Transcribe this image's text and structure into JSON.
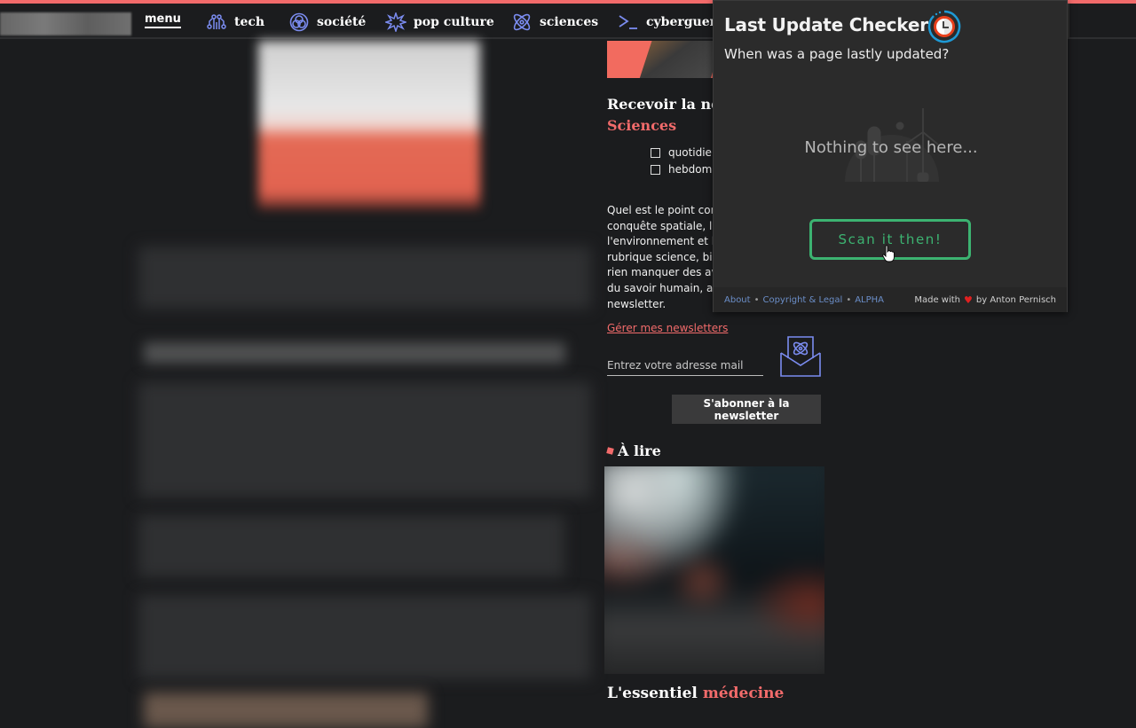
{
  "nav": {
    "menu_label": "menu",
    "items": [
      {
        "label": "tech",
        "icon": "circuit-icon"
      },
      {
        "label": "société",
        "icon": "venn-icon"
      },
      {
        "label": "pop culture",
        "icon": "starburst-icon"
      },
      {
        "label": "sciences",
        "icon": "atom-icon"
      },
      {
        "label": "cyberguerr",
        "icon": "terminal-icon"
      }
    ]
  },
  "newsletter": {
    "title": "Recevoir la nev",
    "title_accent": "Sciences",
    "options": [
      "quotidier",
      "hebdoma"
    ],
    "description": "Quel est le point com conquête spatiale, le l'environnement et la rubrique science, bier rien manquer des ava du savoir humain, ab newsletter.",
    "description_lines": [
      "Quel est le point com",
      "conquête spatiale, le",
      "l'environnement et la",
      "rubrique science, bier",
      "rien manquer des ava",
      "du savoir humain, ab",
      "newsletter."
    ],
    "manage_link": "Gérer mes newsletters",
    "email_placeholder": "Entrez votre adresse mail",
    "subscribe_label": "S'abonner à la newsletter"
  },
  "sections": {
    "a_lire": "À lire",
    "essentiel_prefix": "L'essentiel",
    "essentiel_accent": "médecine"
  },
  "popup": {
    "title": "Last Update Checker",
    "subtitle": "When was a page lastly updated?",
    "empty_message": "Nothing to see here...",
    "scan_button": "Scan it then!",
    "footer": {
      "about": "About",
      "sep": "•",
      "legal": "Copyright & Legal",
      "alpha": "ALPHA",
      "made_with": "Made with",
      "by": "by Anton Pernisch"
    }
  },
  "colors": {
    "accent_red": "#f26b6b",
    "scan_green": "#3cb371",
    "link_blue": "#6b8ec8",
    "icon_blue": "#7b8cf0"
  }
}
